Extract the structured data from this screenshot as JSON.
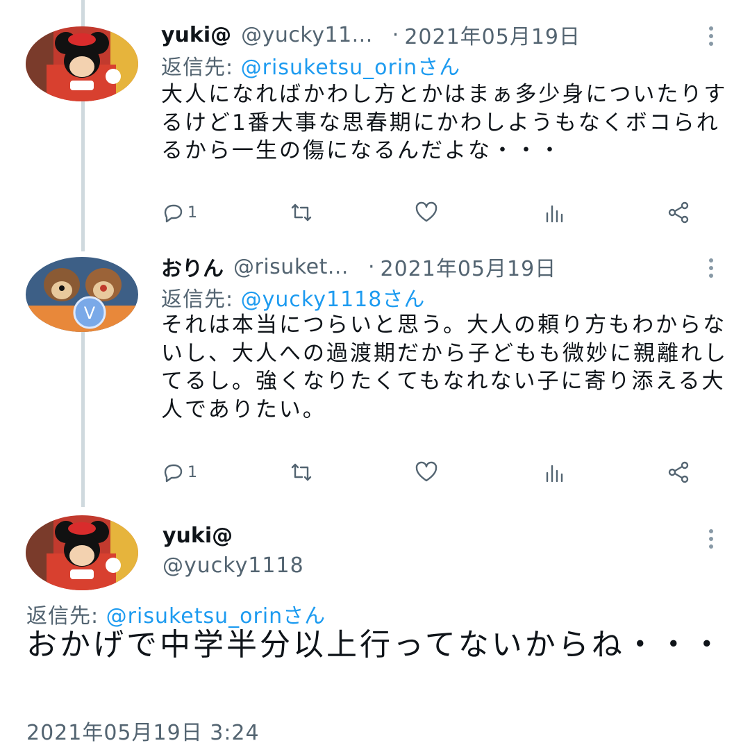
{
  "tweets": [
    {
      "name": "yuki@",
      "handle": "@yucky11...",
      "separator": "·",
      "date": "2021年05月19日",
      "reply_prefix": "返信先: ",
      "reply_mention": "@risuketsu_orinさん",
      "text": "大人になればかわし方とかはまぁ多少身についたりするけど1番大事な思春期にかわしようもなくボコられるから一生の傷になるんだよな・・・",
      "reply_count": "1",
      "avatar_icon": "minnie-mouse-avatar"
    },
    {
      "name": "おりん",
      "handle": "@risuket...",
      "separator": "·",
      "date": "2021年05月19日",
      "reply_prefix": "返信先: ",
      "reply_mention": "@yucky1118さん",
      "text": "それは本当につらいと思う。大人の頼り方もわからないし、大人への過渡期だから子どもも微妙に親離れしてるし。強くなりたくてもなれない子に寄り添える大人でありたい。",
      "reply_count": "1",
      "avatar_icon": "chip-and-dale-avatar"
    }
  ],
  "main_tweet": {
    "name": "yuki@",
    "handle": "@yucky1118",
    "reply_prefix": "返信先: ",
    "reply_mention": "@risuketsu_orinさん",
    "text": "おかげで中学半分以上行ってないからね・・・",
    "timestamp": "2021年05月19日 3:24",
    "avatar_icon": "minnie-mouse-avatar"
  },
  "icons": {
    "reply": "reply-icon",
    "retweet": "retweet-icon",
    "like": "heart-icon",
    "analytics": "analytics-icon",
    "share": "share-icon",
    "more": "more-vertical-icon"
  },
  "colors": {
    "text": "#0f1419",
    "secondary": "#536471",
    "mention": "#1d9bf0",
    "thread_line": "#cfd9de"
  }
}
